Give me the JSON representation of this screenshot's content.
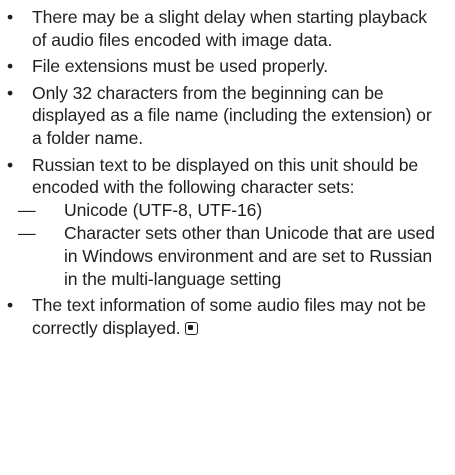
{
  "bullets": [
    "There may be a slight delay when starting playback of audio files encoded with image data.",
    "File extensions must be used properly.",
    "Only 32 characters from the beginning can be displayed as a file name (including the extension) or a folder name.",
    "Russian text to be displayed on this unit should be encoded with the following character sets:",
    "The text information of some audio files may not be correctly displayed."
  ],
  "sub_bullets": [
    "Unicode (UTF-8, UTF-16)",
    "Character sets other than Unicode that are used in Windows environment and are set to Russian in the multi-language setting"
  ],
  "bullet_glyph": "•",
  "dash_glyph": "—",
  "end_mark_icon": "end-of-section-icon"
}
